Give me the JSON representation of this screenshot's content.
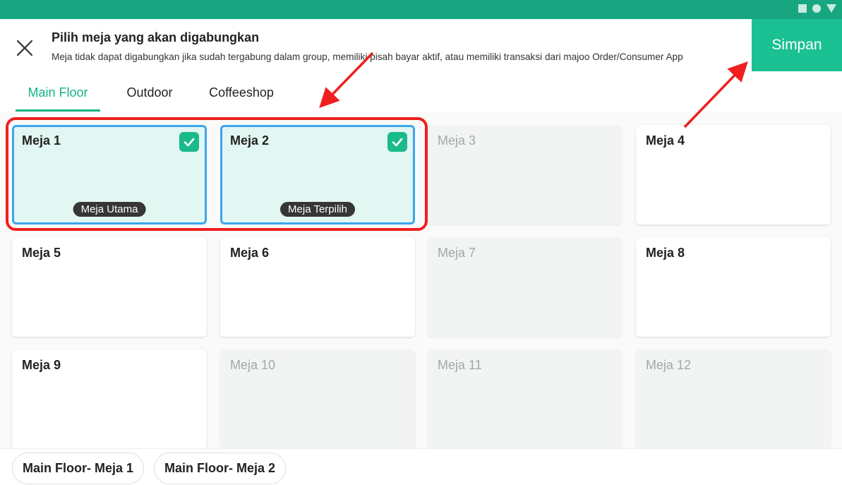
{
  "header": {
    "title": "Pilih meja yang akan digabungkan",
    "subtitle": "Meja tidak dapat digabungkan jika sudah tergabung dalam group, memiliki pisah bayar aktif, atau memiliki transaksi dari majoo Order/Consumer App",
    "save_label": "Simpan"
  },
  "tabs": [
    {
      "label": "Main Floor",
      "active": true
    },
    {
      "label": "Outdoor",
      "active": false
    },
    {
      "label": "Coffeeshop",
      "active": false
    }
  ],
  "tables": [
    {
      "name": "Meja 1",
      "state": "selected",
      "badge": "Meja Utama"
    },
    {
      "name": "Meja 2",
      "state": "selected",
      "badge": "Meja Terpilih"
    },
    {
      "name": "Meja 3",
      "state": "disabled"
    },
    {
      "name": "Meja 4",
      "state": "available"
    },
    {
      "name": "Meja 5",
      "state": "available"
    },
    {
      "name": "Meja 6",
      "state": "available"
    },
    {
      "name": "Meja 7",
      "state": "disabled"
    },
    {
      "name": "Meja 8",
      "state": "available"
    },
    {
      "name": "Meja 9",
      "state": "available"
    },
    {
      "name": "Meja 10",
      "state": "disabled"
    },
    {
      "name": "Meja 11",
      "state": "disabled"
    },
    {
      "name": "Meja 12",
      "state": "disabled"
    }
  ],
  "footer": {
    "chips": [
      "Main Floor- Meja 1",
      "Main Floor- Meja 2"
    ]
  },
  "colors": {
    "accent": "#1bc193",
    "status_bar": "#17a67f",
    "selected_border": "#3aa6ec",
    "selected_fill": "#e2f6f2",
    "annotation": "#ef1f1f"
  },
  "icons": {
    "close": "close-icon",
    "check": "check-icon"
  }
}
